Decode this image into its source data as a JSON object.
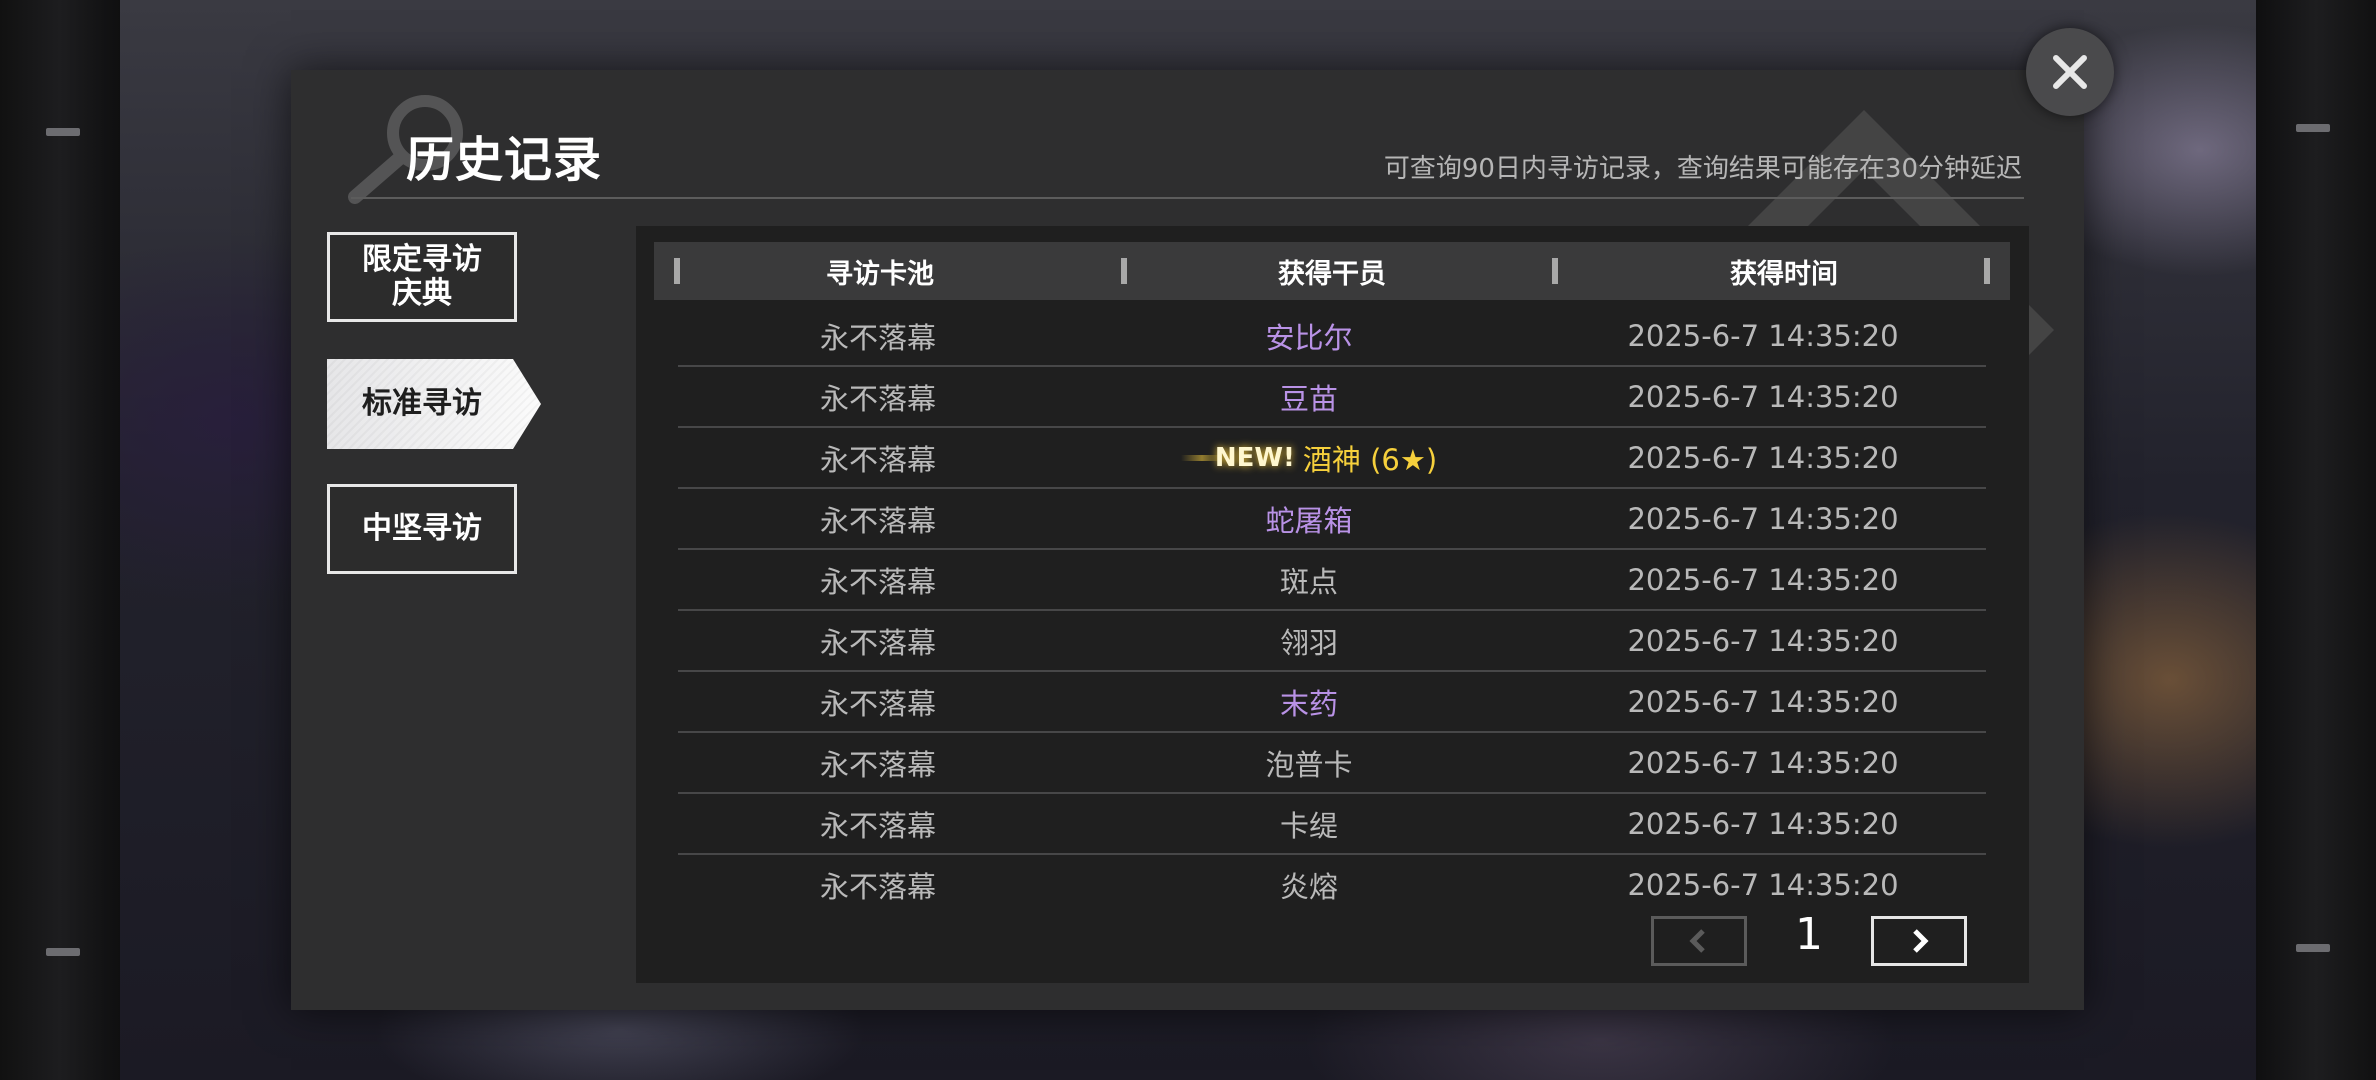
{
  "window": {
    "title": "历史记录",
    "subtitle": "可查询90日内寻访记录，查询结果可能存在30分钟延迟"
  },
  "tabs": [
    {
      "line1": "限定寻访",
      "line2": "庆典",
      "active": false
    },
    {
      "line1": "标准寻访",
      "line2": "",
      "active": true
    },
    {
      "line1": "中坚寻访",
      "line2": "",
      "active": false
    }
  ],
  "table": {
    "headers": [
      "寻访卡池",
      "获得干员",
      "获得时间"
    ],
    "rows": [
      {
        "pool": "永不落幕",
        "operator": "安比尔",
        "time": "2025-6-7 14:35:20",
        "rarity": "rare",
        "new": false
      },
      {
        "pool": "永不落幕",
        "operator": "豆苗",
        "time": "2025-6-7 14:35:20",
        "rarity": "rare",
        "new": false
      },
      {
        "pool": "永不落幕",
        "operator": "酒神 (6★)",
        "time": "2025-6-7 14:35:20",
        "rarity": "gold",
        "new": true
      },
      {
        "pool": "永不落幕",
        "operator": "蛇屠箱",
        "time": "2025-6-7 14:35:20",
        "rarity": "rare",
        "new": false
      },
      {
        "pool": "永不落幕",
        "operator": "斑点",
        "time": "2025-6-7 14:35:20",
        "rarity": "normal",
        "new": false
      },
      {
        "pool": "永不落幕",
        "operator": "翎羽",
        "time": "2025-6-7 14:35:20",
        "rarity": "normal",
        "new": false
      },
      {
        "pool": "永不落幕",
        "operator": "末药",
        "time": "2025-6-7 14:35:20",
        "rarity": "rare",
        "new": false
      },
      {
        "pool": "永不落幕",
        "operator": "泡普卡",
        "time": "2025-6-7 14:35:20",
        "rarity": "normal",
        "new": false
      },
      {
        "pool": "永不落幕",
        "operator": "卡缇",
        "time": "2025-6-7 14:35:20",
        "rarity": "normal",
        "new": false
      },
      {
        "pool": "永不落幕",
        "operator": "炎熔",
        "time": "2025-6-7 14:35:20",
        "rarity": "normal",
        "new": false
      }
    ],
    "new_badge": "NEW!"
  },
  "pagination": {
    "page": "1",
    "prev_icon": "chevron-left-icon",
    "next_icon": "chevron-right-icon"
  },
  "close_icon": "close-icon",
  "colors": {
    "rare": "#b992e6",
    "gold": "#f6d03c",
    "normal": "#b9b9b9",
    "panel": "#2e2e2f",
    "table_bg": "#1f1f1f"
  }
}
